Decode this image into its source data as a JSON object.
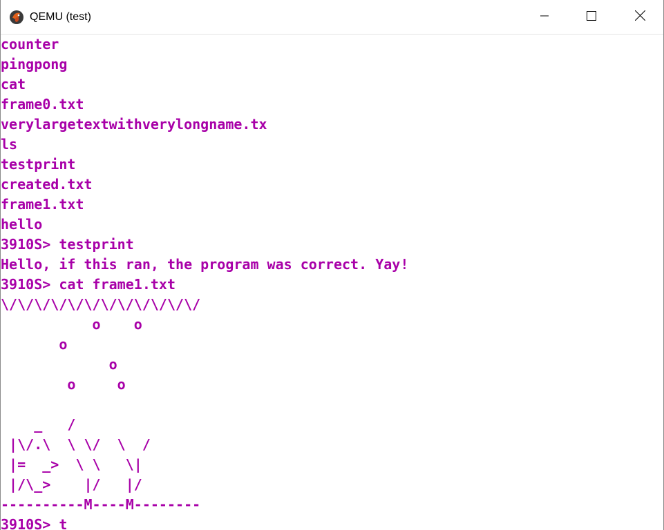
{
  "window": {
    "title": "QEMU (test)",
    "icon": "qemu-logo-icon",
    "controls": {
      "minimize": "minimize-icon",
      "maximize": "maximize-icon",
      "close": "close-icon"
    }
  },
  "colors": {
    "terminal_text": "#a800a8",
    "terminal_bg": "#ffffff"
  },
  "terminal": {
    "lines": [
      "counter",
      "pingpong",
      "cat",
      "frame0.txt",
      "verylargetextwithverylongname.tx",
      "ls",
      "testprint",
      "created.txt",
      "frame1.txt",
      "hello",
      "3910S> testprint",
      "Hello, if this ran, the program was correct. Yay!",
      "3910S> cat frame1.txt",
      "\\/\\/\\/\\/\\/\\/\\/\\/\\/\\/\\/\\/",
      "           o    o",
      "       o",
      "             o",
      "        o     o",
      "",
      "    _   /",
      " |\\/.\\  \\ \\/  \\  /",
      " |=  _>  \\ \\   \\|",
      " |/\\_>    |/   |/",
      "----------M----M--------",
      "3910S> t"
    ]
  }
}
